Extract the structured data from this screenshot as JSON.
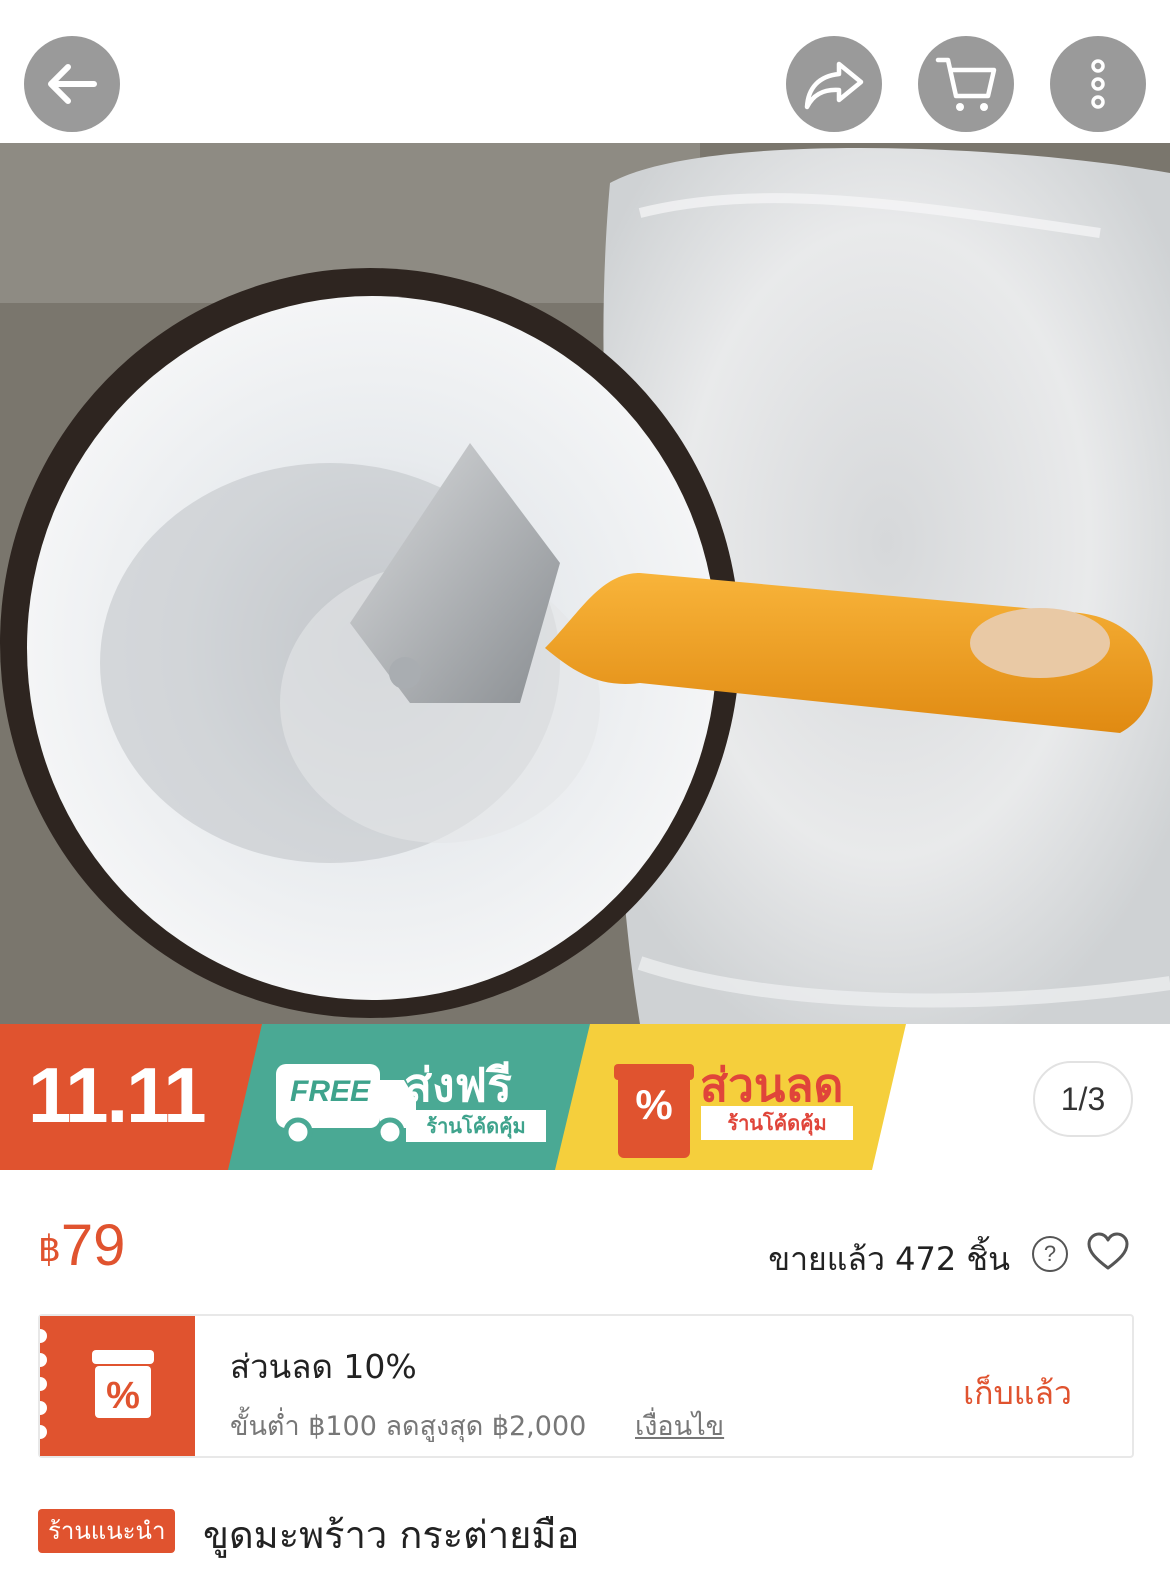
{
  "header": {
    "back_icon": "arrow-left-icon",
    "share_icon": "share-icon",
    "cart_icon": "cart-icon",
    "more_icon": "more-vertical-icon"
  },
  "promo_banner": {
    "event": "11.11",
    "free_label": "FREE",
    "free_shipping": "ส่งฟรี",
    "free_shipping_tag": "ร้านโค้ดคุ้ม",
    "discount": "ส่วนลด",
    "discount_tag": "ร้านโค้ดคุ้ม",
    "percent": "%",
    "page_indicator": "1/3",
    "colors": {
      "event": "#e0532f",
      "shipping": "#4aa994",
      "discount": "#f5cf3c"
    }
  },
  "price": {
    "currency": "฿",
    "amount": "79"
  },
  "sold": {
    "text": "ขายแล้ว 472 ชิ้น",
    "help": "?"
  },
  "voucher": {
    "title": "ส่วนลด 10%",
    "condition": "ขั้นต่ำ ฿100 ลดสูงสุด ฿2,000",
    "terms_link": "เงื่อนไข",
    "status": "เก็บแล้ว",
    "icon": "percent-shop-icon"
  },
  "product": {
    "badge": "ร้านแนะนำ",
    "title": "ขูดมะพร้าว กระต่ายมือ"
  },
  "accent_color": "#e0532f"
}
